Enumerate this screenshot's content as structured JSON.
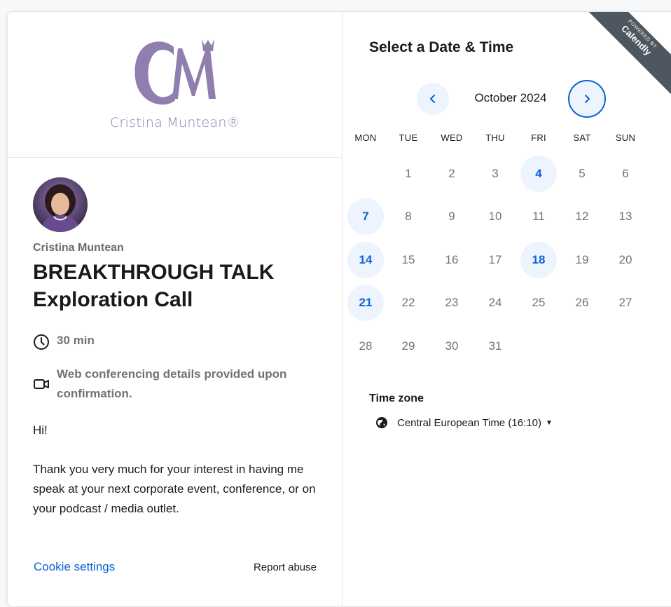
{
  "logo": {
    "monogram": "CM",
    "name": "Cristina Muntean®"
  },
  "event": {
    "host": "Cristina Muntean",
    "title": "BREAKTHROUGH TALK Exploration Call",
    "duration": "30 min",
    "location": "Web conferencing details provided upon confirmation.",
    "description": [
      "Hi!",
      "Thank you very much for your interest in having me speak at your next corporate event, conference, or on your podcast / media outlet."
    ]
  },
  "footer": {
    "cookie_settings": "Cookie settings",
    "report_abuse": "Report abuse"
  },
  "scheduler": {
    "title": "Select a Date & Time",
    "month_label": "October 2024",
    "weekdays": [
      "MON",
      "TUE",
      "WED",
      "THU",
      "FRI",
      "SAT",
      "SUN"
    ],
    "first_weekday_index": 1,
    "days_in_month": 31,
    "available_days": [
      4,
      7,
      14,
      18,
      21
    ],
    "timezone_label": "Time zone",
    "timezone_value": "Central European Time (16:10)"
  },
  "badge": {
    "line1": "POWERED BY",
    "line2": "Calendly"
  },
  "colors": {
    "accent": "#0b62d6",
    "available_bg": "#eef4fe",
    "logo": "#8f7fae",
    "ribbon": "#4e5660"
  },
  "icons": {
    "prev": "chevron-left-icon",
    "next": "chevron-right-icon",
    "duration": "clock-icon",
    "location": "video-camera-icon",
    "timezone": "globe-icon"
  }
}
